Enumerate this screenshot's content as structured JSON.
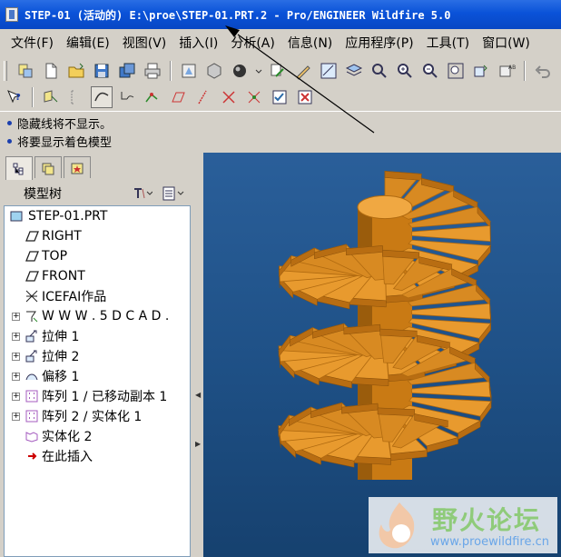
{
  "window": {
    "title": "STEP-01 (活动的) E:\\proe\\STEP-01.PRT.2 - Pro/ENGINEER Wildfire 5.0"
  },
  "menu": [
    {
      "label": "文件(F)"
    },
    {
      "label": "编辑(E)"
    },
    {
      "label": "视图(V)"
    },
    {
      "label": "插入(I)"
    },
    {
      "label": "分析(A)"
    },
    {
      "label": "信息(N)"
    },
    {
      "label": "应用程序(P)"
    },
    {
      "label": "工具(T)"
    },
    {
      "label": "窗口(W)"
    }
  ],
  "messages": [
    {
      "text": "隐藏线将不显示。"
    },
    {
      "text": "将要显示着色模型"
    }
  ],
  "model_tree": {
    "header": "模型树",
    "items": [
      {
        "label": "STEP-01.PRT",
        "icon": "part-icon",
        "expandable": false,
        "root": true
      },
      {
        "label": "RIGHT",
        "icon": "datum-plane-icon",
        "expandable": false
      },
      {
        "label": "TOP",
        "icon": "datum-plane-icon",
        "expandable": false
      },
      {
        "label": "FRONT",
        "icon": "datum-plane-icon",
        "expandable": false
      },
      {
        "label": "ICEFAI作品",
        "icon": "csys-icon",
        "expandable": false
      },
      {
        "label": "W W W . 5 D C A D .",
        "icon": "annotation-icon",
        "expandable": true
      },
      {
        "label": "拉伸 1",
        "icon": "extrude-icon",
        "expandable": true
      },
      {
        "label": "拉伸 2",
        "icon": "extrude-icon",
        "expandable": true
      },
      {
        "label": "偏移 1",
        "icon": "offset-icon",
        "expandable": true
      },
      {
        "label": "阵列 1 / 已移动副本 1",
        "icon": "pattern-icon",
        "expandable": true
      },
      {
        "label": "阵列 2 / 实体化 1",
        "icon": "pattern-icon",
        "expandable": true
      },
      {
        "label": "实体化 2",
        "icon": "solidify-icon",
        "expandable": false
      },
      {
        "label": "在此插入",
        "icon": "insert-here-icon",
        "expandable": false
      }
    ]
  },
  "watermark": {
    "title": "野火论坛",
    "url": "www.proewildfire.cn"
  },
  "colors": {
    "titlebar": "#0a52d8",
    "viewport_bg": "#1f5187",
    "model_orange": "#e89a2e"
  }
}
